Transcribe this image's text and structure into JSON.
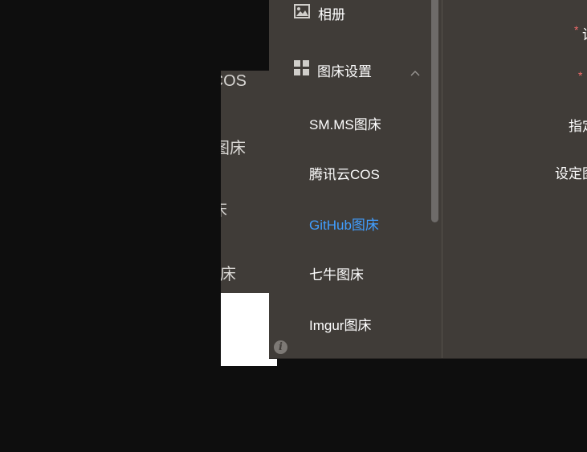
{
  "background_window": {
    "items": [
      "COS",
      "图床",
      "床",
      "床"
    ]
  },
  "sidebar": {
    "album_label": "相册",
    "settings_label": "图床设置",
    "sub_items": [
      "SM.MS图床",
      "腾讯云COS",
      "GitHub图床",
      "七牛图床",
      "Imgur图床"
    ],
    "active_item": "GitHub图床",
    "info_icon": "i"
  },
  "form": {
    "labels": [
      "设",
      "",
      "指定",
      "设定图"
    ],
    "required_marks": [
      "*",
      "*"
    ]
  },
  "colors": {
    "panel": "#403c38",
    "active": "#409eff",
    "required": "#f56c6c"
  }
}
